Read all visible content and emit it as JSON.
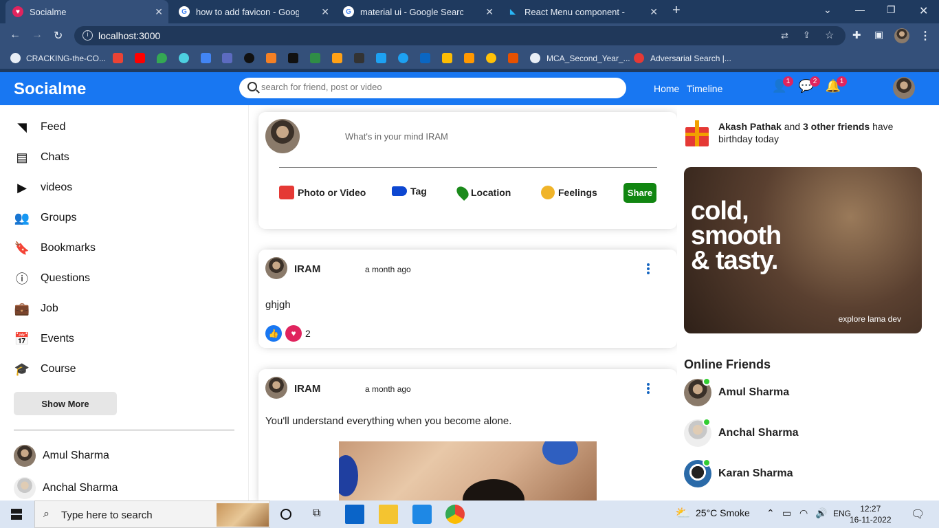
{
  "browser": {
    "tabs": [
      {
        "title": "Socialme",
        "favicon": "socialme-favicon"
      },
      {
        "title": "how to add favicon - Google Sea",
        "favicon": "google-icon"
      },
      {
        "title": "material ui - Google Search",
        "favicon": "google-icon"
      },
      {
        "title": "React Menu component - Materi",
        "favicon": "mui-icon"
      }
    ],
    "new_tab": "+",
    "url": "localhost:3000",
    "bookmarks": [
      {
        "label": "CRACKING-the-CO..."
      },
      {
        "label": "MCA_Second_Year_..."
      },
      {
        "label": "Adversarial Search |..."
      }
    ]
  },
  "app": {
    "logo": "Socialme",
    "search_placeholder": "search for friend, post or video",
    "nav": {
      "home": "Home",
      "timeline": "Timeline"
    },
    "badges": {
      "friends": "1",
      "messages": "2",
      "notifications": "1"
    }
  },
  "sidebar": {
    "items": [
      {
        "label": "Feed",
        "icon": "rss-feed-icon"
      },
      {
        "label": "Chats",
        "icon": "chat-icon"
      },
      {
        "label": "videos",
        "icon": "play-circle-icon"
      },
      {
        "label": "Groups",
        "icon": "group-icon"
      },
      {
        "label": "Bookmarks",
        "icon": "bookmark-icon"
      },
      {
        "label": "Questions",
        "icon": "help-outline-icon"
      },
      {
        "label": "Job",
        "icon": "work-outline-icon"
      },
      {
        "label": "Events",
        "icon": "event-icon"
      },
      {
        "label": "Course",
        "icon": "school-icon"
      }
    ],
    "show_more": "Show More",
    "friends": [
      "Amul Sharma",
      "Anchal Sharma"
    ]
  },
  "share": {
    "placeholder": "What's in your mind IRAM",
    "options": {
      "photo": "Photo or Video",
      "tag": "Tag",
      "location": "Location",
      "feelings": "Feelings"
    },
    "share_button": "Share",
    "colors": {
      "photo": "#e53935",
      "tag": "#0d47d1",
      "location": "#1b8a1b",
      "feelings": "#f0b429"
    }
  },
  "posts": [
    {
      "user": "IRAM",
      "date": "a month ago",
      "text": "ghjgh",
      "likes": "2"
    },
    {
      "user": "IRAM",
      "date": "a month ago",
      "text": "You'll understand everything when you become alone."
    }
  ],
  "rightbar": {
    "birthday": {
      "name": "Akash Pathak",
      "and": " and ",
      "others": "3 other friends",
      "rest": " have birthday today"
    },
    "ad": {
      "headline": [
        "cold,",
        "smooth",
        "& tasty."
      ],
      "tagline": "explore lama dev"
    },
    "online_title": "Online Friends",
    "online_friends": [
      "Amul Sharma",
      "Anchal Sharma",
      "Karan Sharma"
    ]
  },
  "taskbar": {
    "search_placeholder": "Type here to search",
    "weather": "25°C  Smoke",
    "lang": "ENG",
    "time": "12:27",
    "date": "16-11-2022"
  },
  "colors": {
    "brand": "#1877f2",
    "share": "#118611",
    "online": "#32cd32"
  }
}
